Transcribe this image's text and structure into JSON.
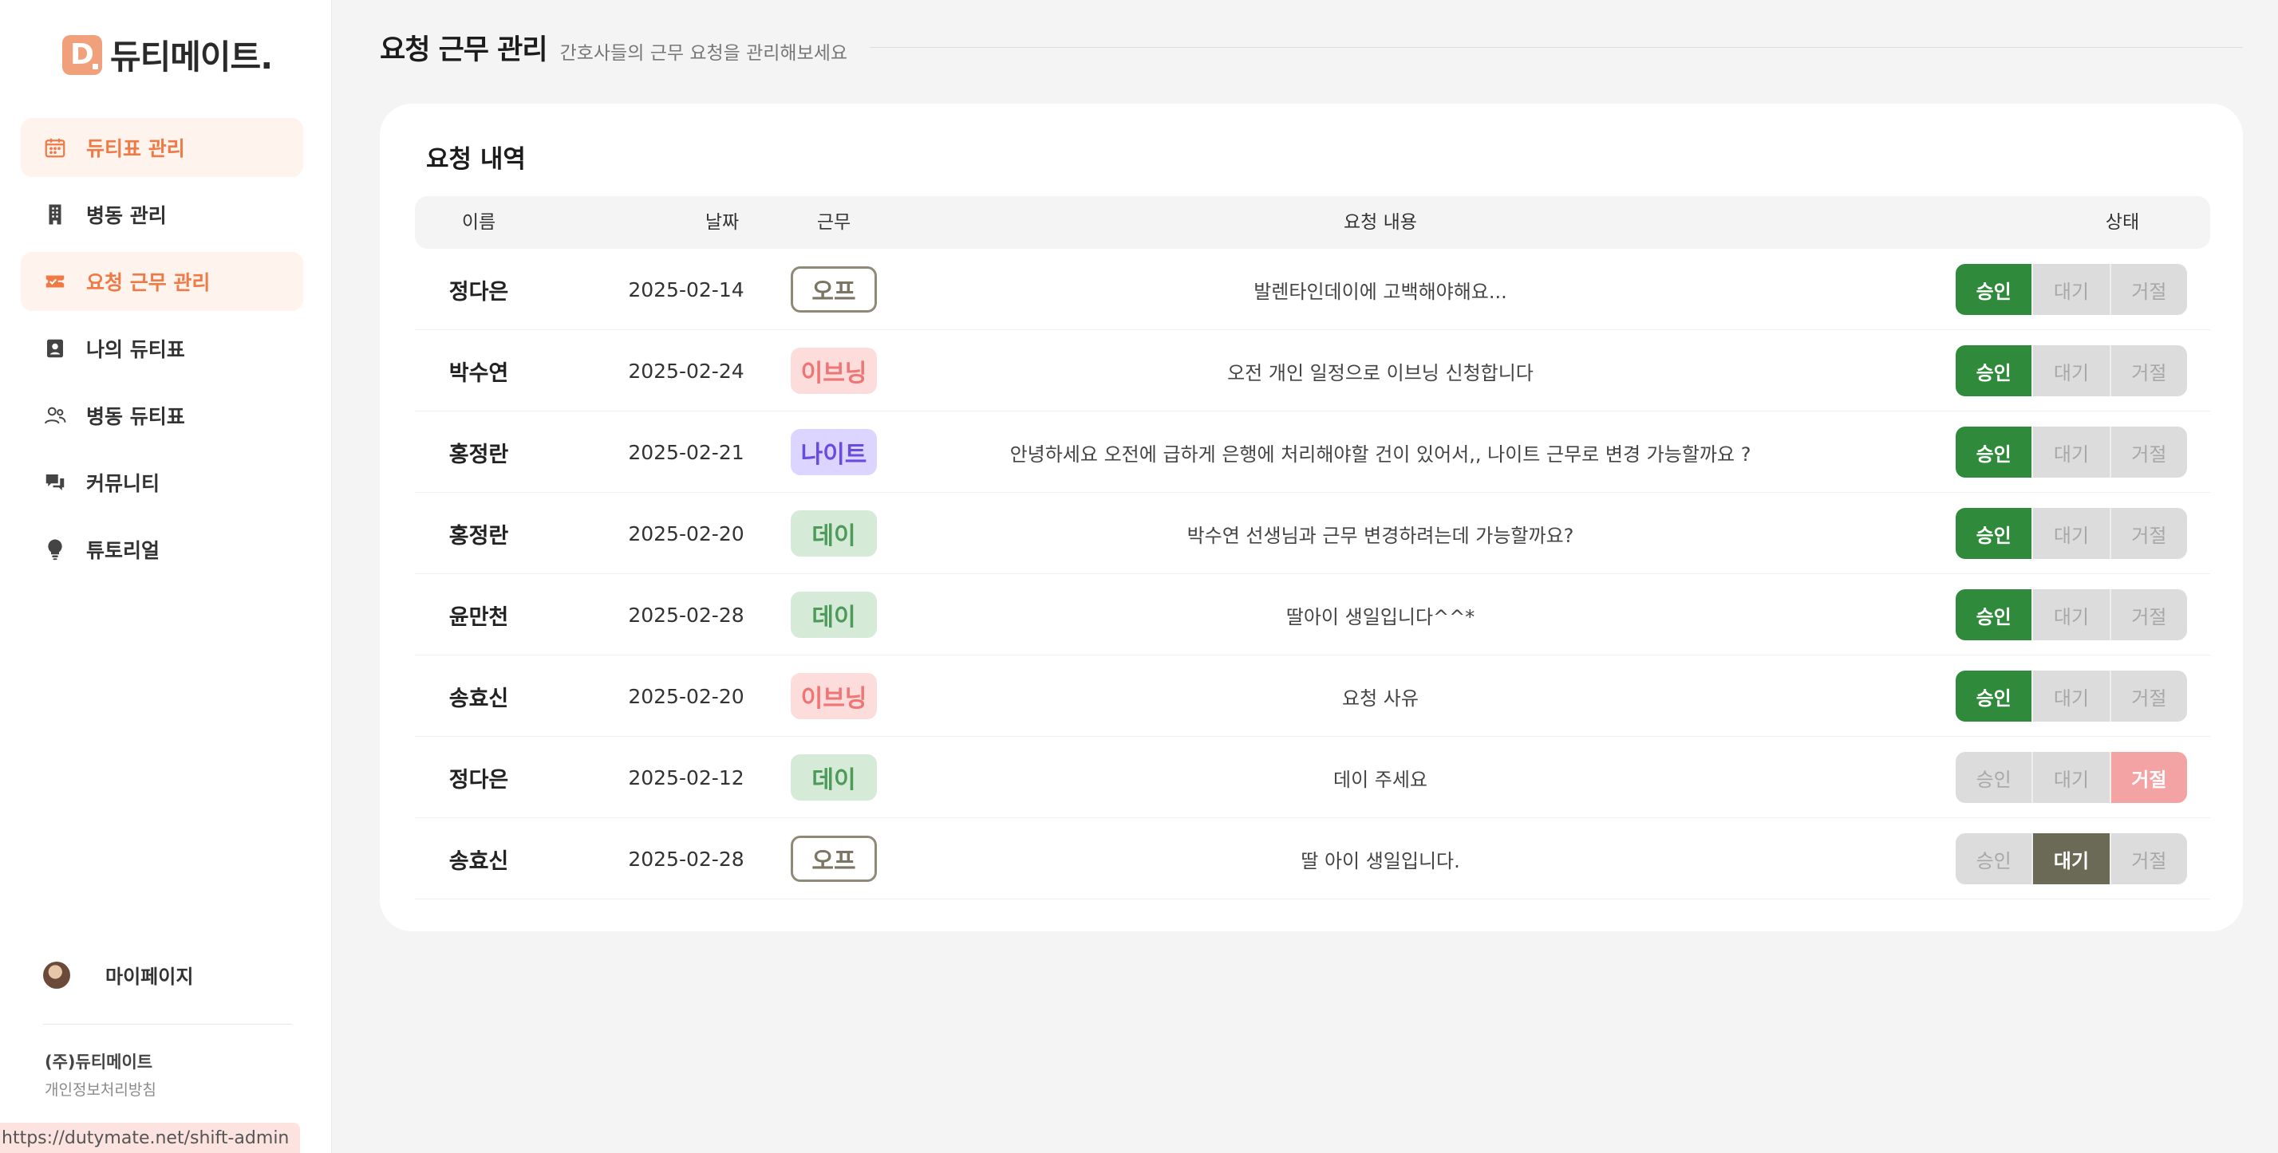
{
  "brand": {
    "mark": "D.",
    "name": "듀티메이트."
  },
  "nav": [
    {
      "label": "듀티표 관리",
      "icon": "calendar-icon"
    },
    {
      "label": "병동 관리",
      "icon": "building-icon"
    },
    {
      "label": "요청 근무 관리",
      "icon": "ticket-icon"
    },
    {
      "label": "나의 듀티표",
      "icon": "profile-card-icon"
    },
    {
      "label": "병동 듀티표",
      "icon": "users-icon"
    },
    {
      "label": "커뮤니티",
      "icon": "chat-icon"
    },
    {
      "label": "튜토리얼",
      "icon": "lightbulb-icon"
    }
  ],
  "footer": {
    "mypage": "마이페이지",
    "company": "(주)듀티메이트",
    "privacy": "개인정보처리방침",
    "url_tooltip": "https://dutymate.net/shift-admin"
  },
  "header": {
    "title": "요청 근무 관리",
    "subtitle": "간호사들의 근무 요청을 관리해보세요"
  },
  "card": {
    "title": "요청 내역",
    "columns": {
      "name": "이름",
      "date": "날짜",
      "shift": "근무",
      "request": "요청 내용",
      "status": "상태"
    }
  },
  "status_labels": {
    "approve": "승인",
    "wait": "대기",
    "reject": "거절"
  },
  "colors": {
    "accent": "#f07a45",
    "approve": "#2f8a3b",
    "wait": "#6b6a57",
    "reject": "#f3a3a3"
  },
  "rows": [
    {
      "name": "정다은",
      "date": "2025-02-14",
      "shift": "오프",
      "shift_type": "off",
      "request": "발렌타인데이에 고백해야해요...",
      "status": "approve"
    },
    {
      "name": "박수연",
      "date": "2025-02-24",
      "shift": "이브닝",
      "shift_type": "evening",
      "request": "오전 개인 일정으로 이브닝 신청합니다",
      "status": "approve"
    },
    {
      "name": "홍정란",
      "date": "2025-02-21",
      "shift": "나이트",
      "shift_type": "night",
      "request": "안녕하세요 오전에 급하게 은행에 처리해야할 건이 있어서,, 나이트 근무로 변경 가능할까요 ?",
      "status": "approve"
    },
    {
      "name": "홍정란",
      "date": "2025-02-20",
      "shift": "데이",
      "shift_type": "day",
      "request": "박수연 선생님과 근무 변경하려는데 가능할까요?",
      "status": "approve"
    },
    {
      "name": "윤만천",
      "date": "2025-02-28",
      "shift": "데이",
      "shift_type": "day",
      "request": "딸아이 생일입니다^^*",
      "status": "approve"
    },
    {
      "name": "송효신",
      "date": "2025-02-20",
      "shift": "이브닝",
      "shift_type": "evening",
      "request": "요청 사유",
      "status": "approve"
    },
    {
      "name": "정다은",
      "date": "2025-02-12",
      "shift": "데이",
      "shift_type": "day",
      "request": "데이 주세요",
      "status": "reject"
    },
    {
      "name": "송효신",
      "date": "2025-02-28",
      "shift": "오프",
      "shift_type": "off",
      "request": "딸 아이 생일입니다.",
      "status": "wait"
    }
  ]
}
